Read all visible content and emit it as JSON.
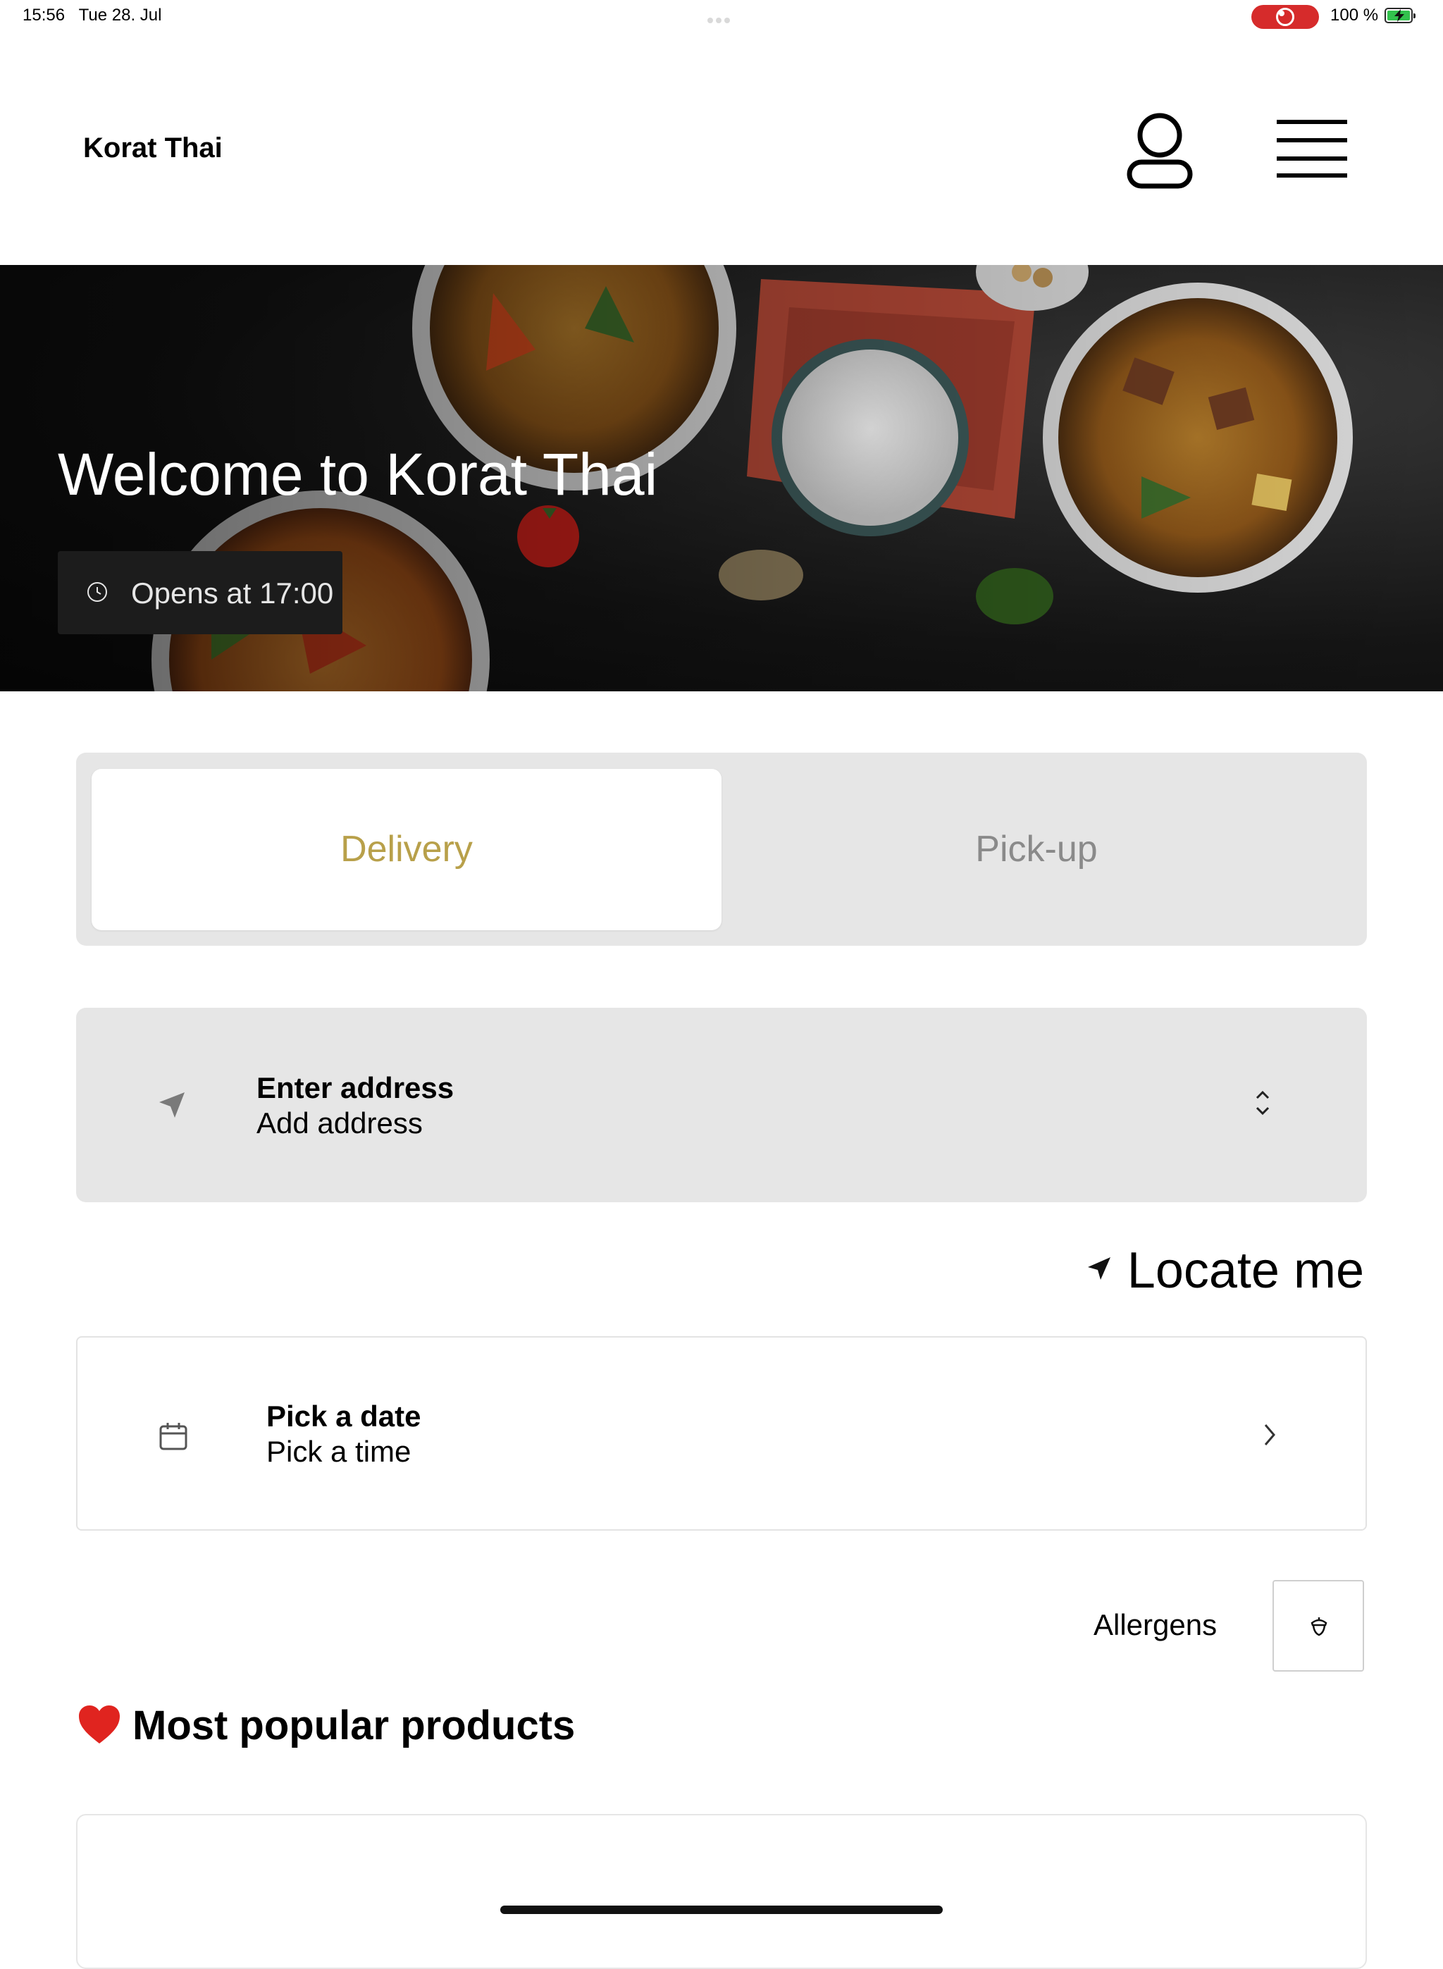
{
  "status_bar": {
    "time": "15:56",
    "date": "Tue 28. Jul",
    "battery_percent": "100 %",
    "battery_level": 1.0
  },
  "header": {
    "brand": "Korat Thai",
    "profile_icon": "person-outline-icon",
    "menu_icon": "hamburger-menu-icon"
  },
  "hero": {
    "title": "Welcome to Korat Thai",
    "hours": "Opens at 17:00",
    "hours_icon": "clock-icon"
  },
  "order_mode": {
    "tabs": [
      {
        "label": "Delivery",
        "active": true
      },
      {
        "label": "Pick-up",
        "active": false
      }
    ],
    "active_color": "#b8a04a",
    "inactive_color": "#8a8a8a"
  },
  "address": {
    "title": "Enter address",
    "subtitle": "Add address",
    "icon": "location-arrow-icon"
  },
  "locate": {
    "label": "Locate me",
    "icon": "location-arrow-icon"
  },
  "schedule": {
    "title": "Pick a date",
    "subtitle": "Pick a time",
    "icon": "calendar-icon"
  },
  "allergens": {
    "label": "Allergens",
    "icon": "acorn-icon"
  },
  "popular": {
    "emoji": "❤️",
    "title": "Most popular products"
  }
}
